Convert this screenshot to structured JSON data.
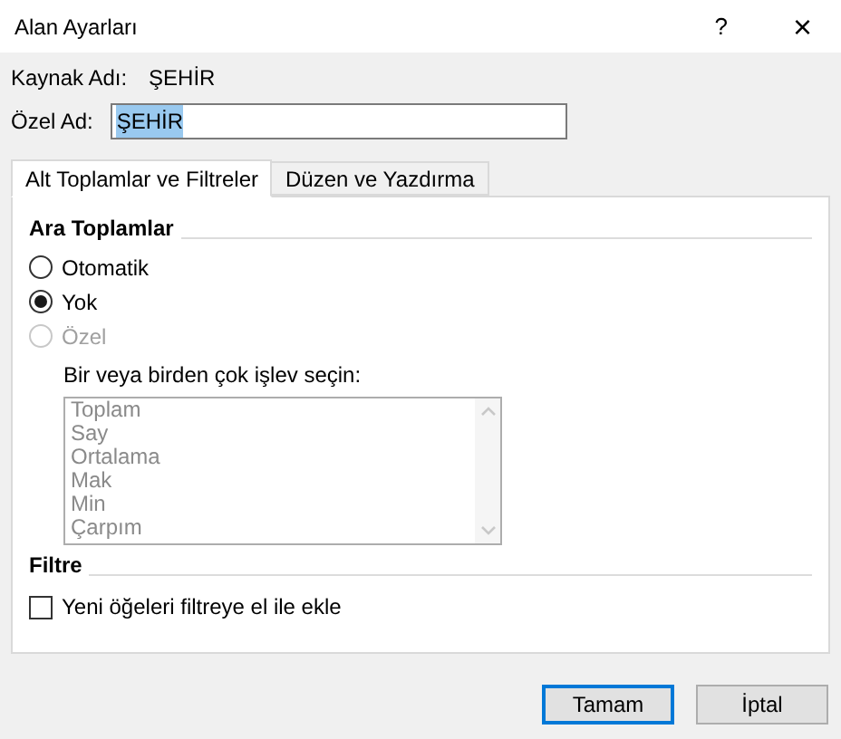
{
  "window": {
    "title": "Alan Ayarları",
    "help": "?",
    "close": "×"
  },
  "source_name": {
    "label": "Kaynak Adı:",
    "value": "ŞEHİR"
  },
  "custom_name": {
    "label": "Özel Ad:",
    "value": "ŞEHİR",
    "selected": true
  },
  "tabs": [
    {
      "label": "Alt Toplamlar ve Filtreler",
      "selected": true
    },
    {
      "label": "Düzen ve Yazdırma",
      "selected": false
    }
  ],
  "subtotals": {
    "heading": "Ara Toplamlar",
    "options": [
      {
        "label": "Otomatik",
        "selected": false,
        "disabled": false
      },
      {
        "label": "Yok",
        "selected": true,
        "disabled": false
      },
      {
        "label": "Özel",
        "selected": false,
        "disabled": true
      }
    ],
    "function_prompt": "Bir veya birden çok işlev seçin:",
    "functions_disabled": true,
    "functions": [
      "Toplam",
      "Say",
      "Ortalama",
      "Mak",
      "Min",
      "Çarpım"
    ]
  },
  "filter": {
    "heading": "Filtre",
    "checkbox": {
      "label": "Yeni öğeleri filtreye el ile ekle",
      "checked": false
    }
  },
  "buttons": [
    {
      "label": "Tamam",
      "default": true
    },
    {
      "label": "İptal",
      "default": false
    }
  ]
}
